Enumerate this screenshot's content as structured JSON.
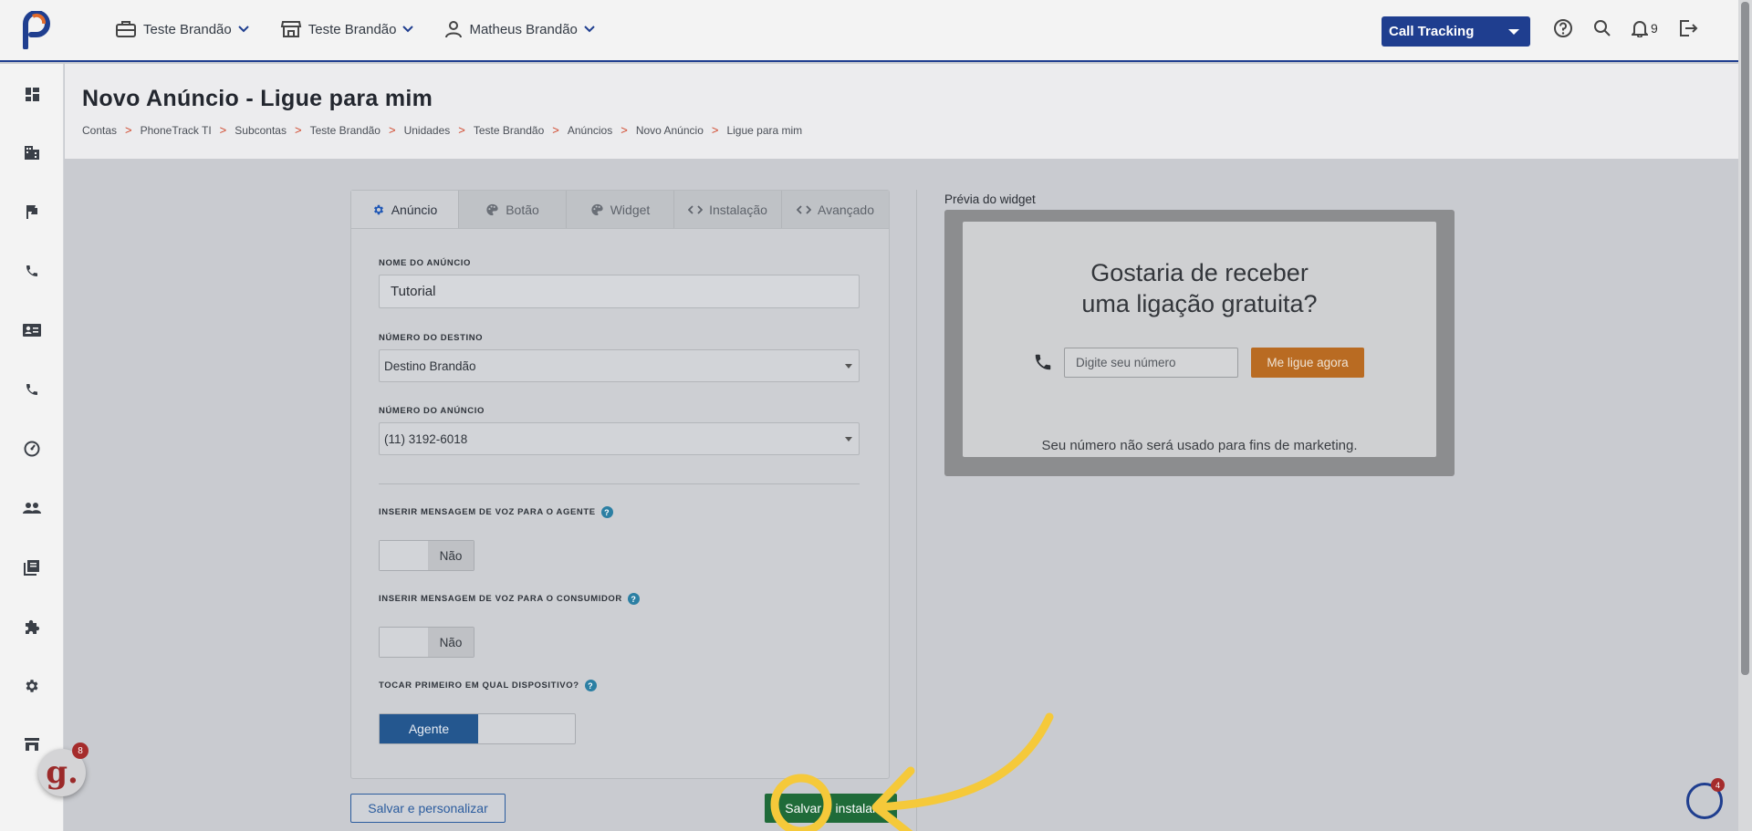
{
  "topbar": {
    "menus": [
      {
        "label": "Teste Brandão",
        "icon": "briefcase-icon"
      },
      {
        "label": "Teste Brandão",
        "icon": "store-icon"
      },
      {
        "label": "Matheus Brandão",
        "icon": "user-icon"
      }
    ],
    "product_select": "Call Tracking",
    "notification_count": "9"
  },
  "sidebar": {
    "items": [
      "dashboard-icon",
      "building-icon",
      "flag-icon",
      "phone-icon",
      "contact-card-icon",
      "phone-icon",
      "speed-icon",
      "people-icon",
      "book-icon",
      "puzzle-icon",
      "settings-icon",
      "store-icon"
    ]
  },
  "page": {
    "title": "Novo Anúncio - Ligue para mim",
    "breadcrumb": [
      "Contas",
      "PhoneTrack TI",
      "Subcontas",
      "Teste Brandão",
      "Unidades",
      "Teste Brandão",
      "Anúncios",
      "Novo Anúncio",
      "Ligue para mim"
    ],
    "breadcrumb_sep": ">"
  },
  "tabs": [
    {
      "label": "Anúncio",
      "active": true
    },
    {
      "label": "Botão",
      "active": false
    },
    {
      "label": "Widget",
      "active": false
    },
    {
      "label": "Instalação",
      "active": false
    },
    {
      "label": "Avançado",
      "active": false
    }
  ],
  "form": {
    "ad_name_label": "NOME DO ANÚNCIO",
    "ad_name_value": "Tutorial",
    "destination_label": "NÚMERO DO DESTINO",
    "destination_value": "Destino Brandão",
    "ad_number_label": "NÚMERO DO ANÚNCIO",
    "ad_number_value": "(11) 3192-6018",
    "voice_agent_label": "INSERIR MENSAGEM DE VOZ PARA O AGENTE",
    "voice_agent_value": "Não",
    "voice_consumer_label": "INSERIR MENSAGEM DE VOZ PARA O CONSUMIDOR",
    "voice_consumer_value": "Não",
    "ring_first_label": "TOCAR PRIMEIRO EM QUAL DISPOSITIVO?",
    "ring_first_value": "Agente",
    "help_glyph": "?"
  },
  "actions": {
    "save_customize": "Salvar e personalizar",
    "save_install": "Salvar e instalar"
  },
  "preview": {
    "label": "Prévia do widget",
    "title_line1": "Gostaria de receber",
    "title_line2": "uma ligação gratuita?",
    "input_placeholder": "Digite seu número",
    "button": "Me ligue agora",
    "note": "Seu número não será usado para fins de marketing."
  },
  "floating": {
    "g_letter": "g.",
    "g_count": "8",
    "p_count": "4"
  },
  "colors": {
    "brand_blue": "#1f3e8f",
    "accent_red": "#d1492e",
    "save_green": "#1f6b39",
    "preview_orange": "#b96b22",
    "highlight_yellow": "#f5c93a"
  }
}
